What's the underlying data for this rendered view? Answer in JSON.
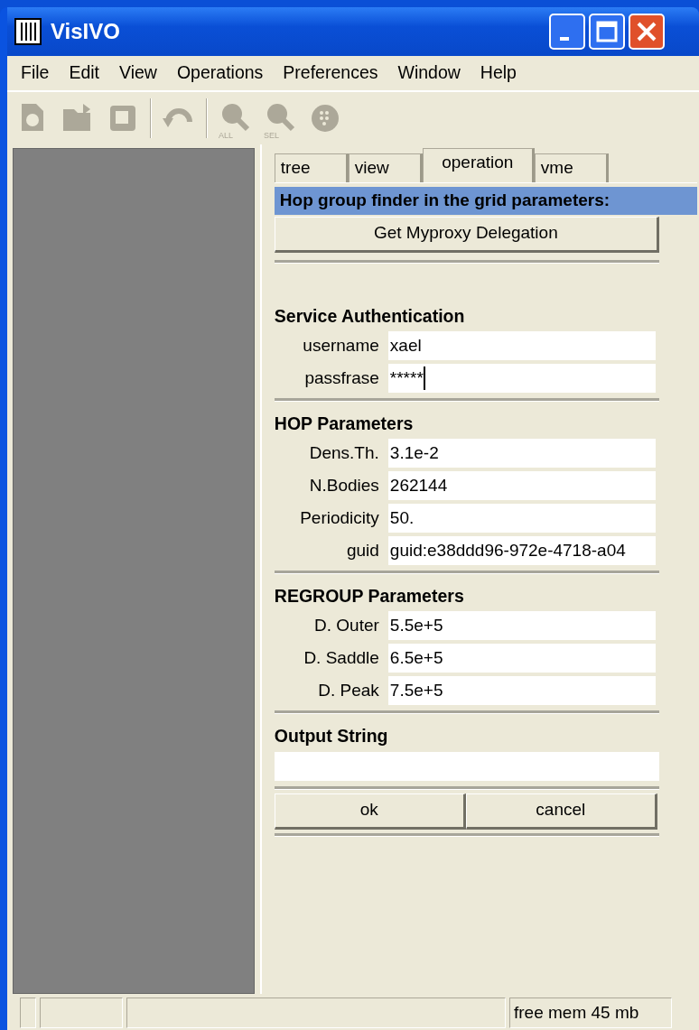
{
  "window": {
    "title": "VisIVO"
  },
  "menu": [
    "File",
    "Edit",
    "View",
    "Operations",
    "Preferences",
    "Window",
    "Help"
  ],
  "toolbar": [
    {
      "kind": "page",
      "disabled": true
    },
    {
      "kind": "open",
      "disabled": true
    },
    {
      "kind": "save",
      "disabled": true
    },
    {
      "kind": "separator"
    },
    {
      "kind": "undo",
      "disabled": true
    },
    {
      "kind": "separator"
    },
    {
      "kind": "zoom",
      "caption": "ALL",
      "disabled": true
    },
    {
      "kind": "zoom",
      "caption": "SEL",
      "disabled": true
    },
    {
      "kind": "globe",
      "disabled": true
    }
  ],
  "tabs": [
    {
      "label": "tree",
      "selected": false
    },
    {
      "label": "view",
      "selected": false
    },
    {
      "label": "operation",
      "selected": true
    },
    {
      "label": "vme",
      "selected": false
    }
  ],
  "panel": {
    "header": "Hop group finder in the grid parameters:",
    "top_button": "Get Myproxy Delegation",
    "sections": [
      {
        "title": "Service Authentication",
        "fields": [
          {
            "label": "username",
            "value": "xael"
          },
          {
            "label": "passfrase",
            "value": "*****",
            "focused": true
          }
        ]
      },
      {
        "title": "HOP Parameters",
        "fields": [
          {
            "label": "Dens.Th.",
            "value": "3.1e-2"
          },
          {
            "label": "N.Bodies",
            "value": "262144"
          },
          {
            "label": "Periodicity",
            "value": "50."
          },
          {
            "label": "guid",
            "value": "guid:e38ddd96-972e-4718-a04"
          }
        ]
      },
      {
        "title": "REGROUP Parameters",
        "fields": [
          {
            "label": "D. Outer",
            "value": "5.5e+5"
          },
          {
            "label": "D. Saddle",
            "value": "6.5e+5"
          },
          {
            "label": "D. Peak",
            "value": "7.5e+5"
          }
        ]
      },
      {
        "title": "Output String",
        "fields": [
          {
            "kind": "wide"
          }
        ]
      }
    ],
    "buttons": [
      "ok",
      "cancel"
    ]
  },
  "status_bar": [
    "free mem 45 mb"
  ]
}
